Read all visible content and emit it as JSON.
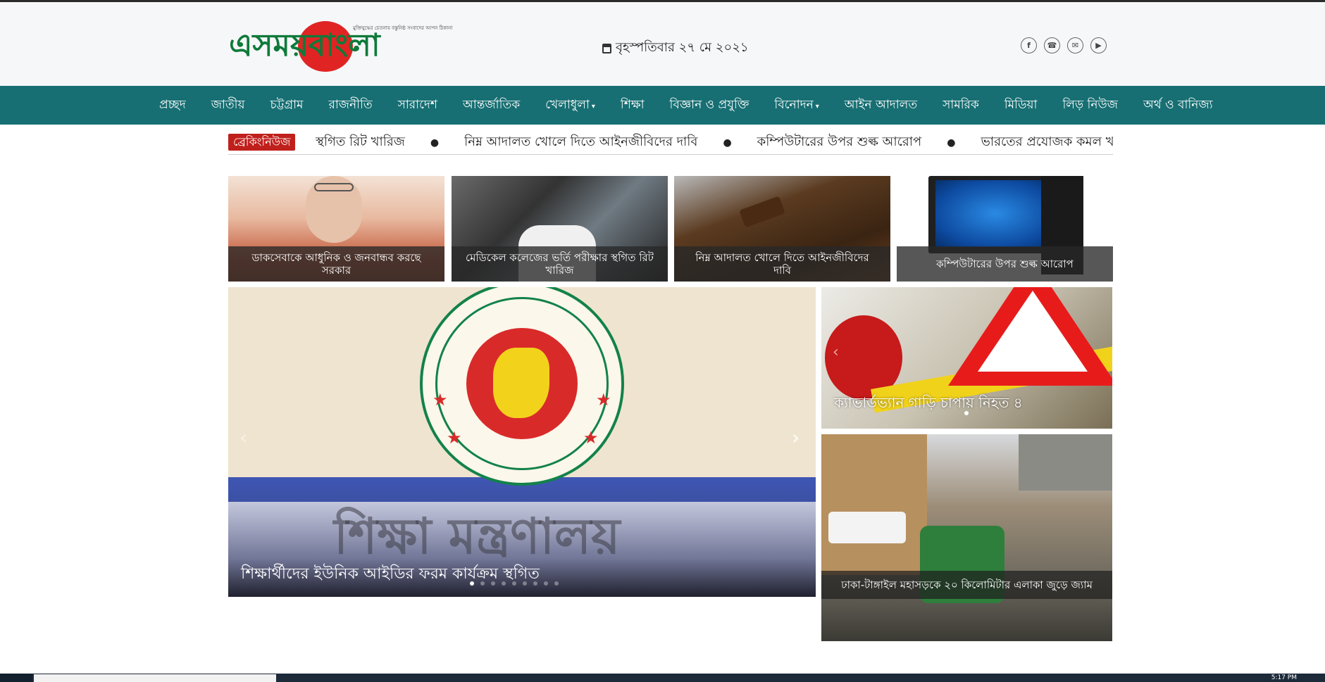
{
  "logo": {
    "part1": "এসময়",
    "part2": "বাংলা",
    "tagline": "মুক্তিযুদ্ধের চেতনায় বস্তুনিষ্ঠ সংবাদের আপন ঠিকানা"
  },
  "date_text": "বৃহস্পতিবার ২৭ মে ২০২১",
  "social": [
    "f",
    "☎",
    "✉",
    "▶"
  ],
  "nav": [
    {
      "label": "প্রচ্ছদ",
      "dropdown": false
    },
    {
      "label": "জাতীয়",
      "dropdown": false
    },
    {
      "label": "চট্টগ্রাম",
      "dropdown": false
    },
    {
      "label": "রাজনীতি",
      "dropdown": false
    },
    {
      "label": "সারাদেশ",
      "dropdown": false
    },
    {
      "label": "আন্তর্জাতিক",
      "dropdown": false
    },
    {
      "label": "খেলাধুলা",
      "dropdown": true
    },
    {
      "label": "শিক্ষা",
      "dropdown": false
    },
    {
      "label": "বিজ্ঞান ও প্রযুক্তি",
      "dropdown": false
    },
    {
      "label": "বিনোদন",
      "dropdown": true
    },
    {
      "label": "আইন আদালত",
      "dropdown": false
    },
    {
      "label": "সামরিক",
      "dropdown": false
    },
    {
      "label": "মিডিয়া",
      "dropdown": false
    },
    {
      "label": "লিড় নিউজ",
      "dropdown": false
    },
    {
      "label": "অর্থ ও বানিজ্য",
      "dropdown": false
    }
  ],
  "breaking": {
    "label": "ব্রেকিংনিউজ",
    "items": [
      "স্থগিত রিট খারিজ",
      "নিম্ন আদালত খোলে দিতে আইনজীবিদের দাবি",
      "কম্পিউটারের উপর শুল্ক আরোপ",
      "ভারতের প্রযোজক কমল খানের বিরুদ্ধে মামলা"
    ]
  },
  "thumbs": [
    {
      "caption": "ডাকসেবাকে আধুনিক ও জনবান্ধব করছে সরকার"
    },
    {
      "caption": "মেডিকেল কলেজের ভর্তি পরীক্ষার স্থগিত রিট খারিজ"
    },
    {
      "caption": "নিম্ন আদালত খোলে দিতে আইনজীবিদের দাবি"
    },
    {
      "caption": "কম্পিউটারের উপর শুল্ক আরোপ"
    }
  ],
  "main_slider": {
    "caption": "শিক্ষার্থীদের ইউনিক আইডির ফরম কার্যক্রম স্থগিত",
    "image_text": "শিক্ষা মন্ত্রণালয়",
    "slide_count": 9,
    "active_slide": 1
  },
  "side_top": {
    "caption": "ক্যাভার্ডভ্যান গাড়ি চাপায় নিহত ৪"
  },
  "side_bottom": {
    "caption": "ঢাকা-টাঙ্গাইল মহাসড়কে ২০ কিলোমিটার এলাকা জুড়ে জ্যাম"
  },
  "taskbar": {
    "clock": "5:17 PM"
  },
  "colors": {
    "nav_bg": "#176f73",
    "breaking_label": "#c0201c",
    "logo_green": "#0e7a3a",
    "logo_red": "#e02424"
  }
}
